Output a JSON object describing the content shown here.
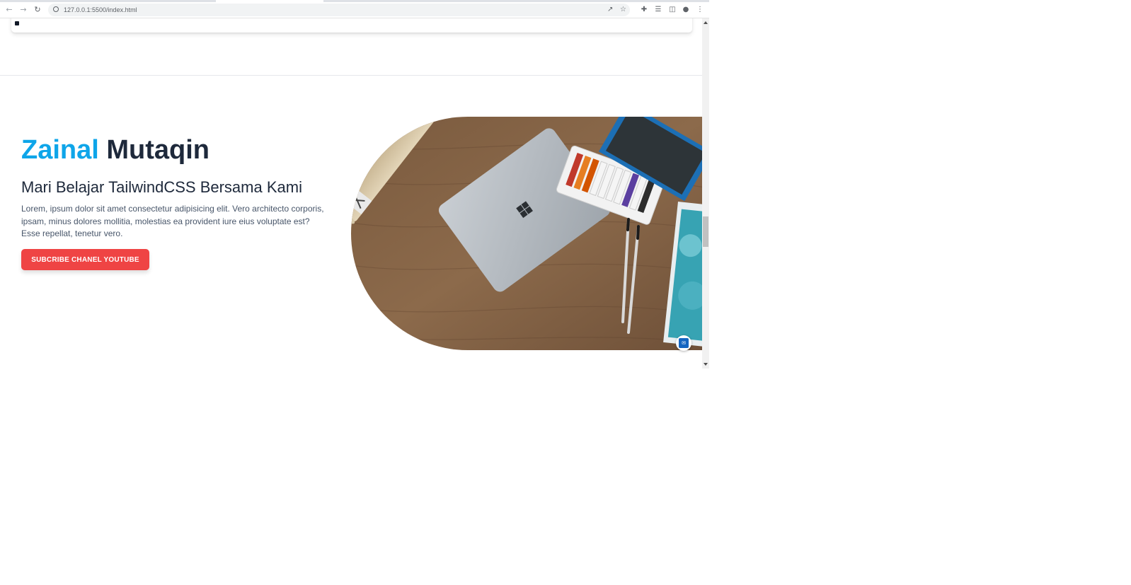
{
  "browser": {
    "url": "127.0.0.1:5500/index.html",
    "icons": {
      "back": "arrow-left-icon",
      "forward": "arrow-right-icon",
      "reload": "reload-icon",
      "site_info": "info-icon",
      "share": "share-icon",
      "bookmark": "star-icon",
      "extensions": "puzzle-icon",
      "reading_list": "reading-list-icon",
      "side_panel": "side-panel-icon",
      "profile": "profile-icon",
      "menu": "kebab-menu-icon"
    }
  },
  "hero": {
    "first_name": "Zainal",
    "last_name": "Mutaqin",
    "subtitle": "Mari Belajar TailwindCSS Bersama Kami",
    "description": "Lorem, ipsum dolor sit amet consectetur adipisicing elit. Vero architecto corporis, ipsam, minus dolores mollitia, molestias ea provident iure eius voluptate est? Esse repellat, tenetur vero.",
    "cta_label": "SUBCRIBE CHANEL YOUTUBE",
    "image_subject": "laptop-on-desk-photo"
  },
  "colors": {
    "accent": "#0ea5e9",
    "heading": "#1e293b",
    "cta": "#ef4444"
  }
}
